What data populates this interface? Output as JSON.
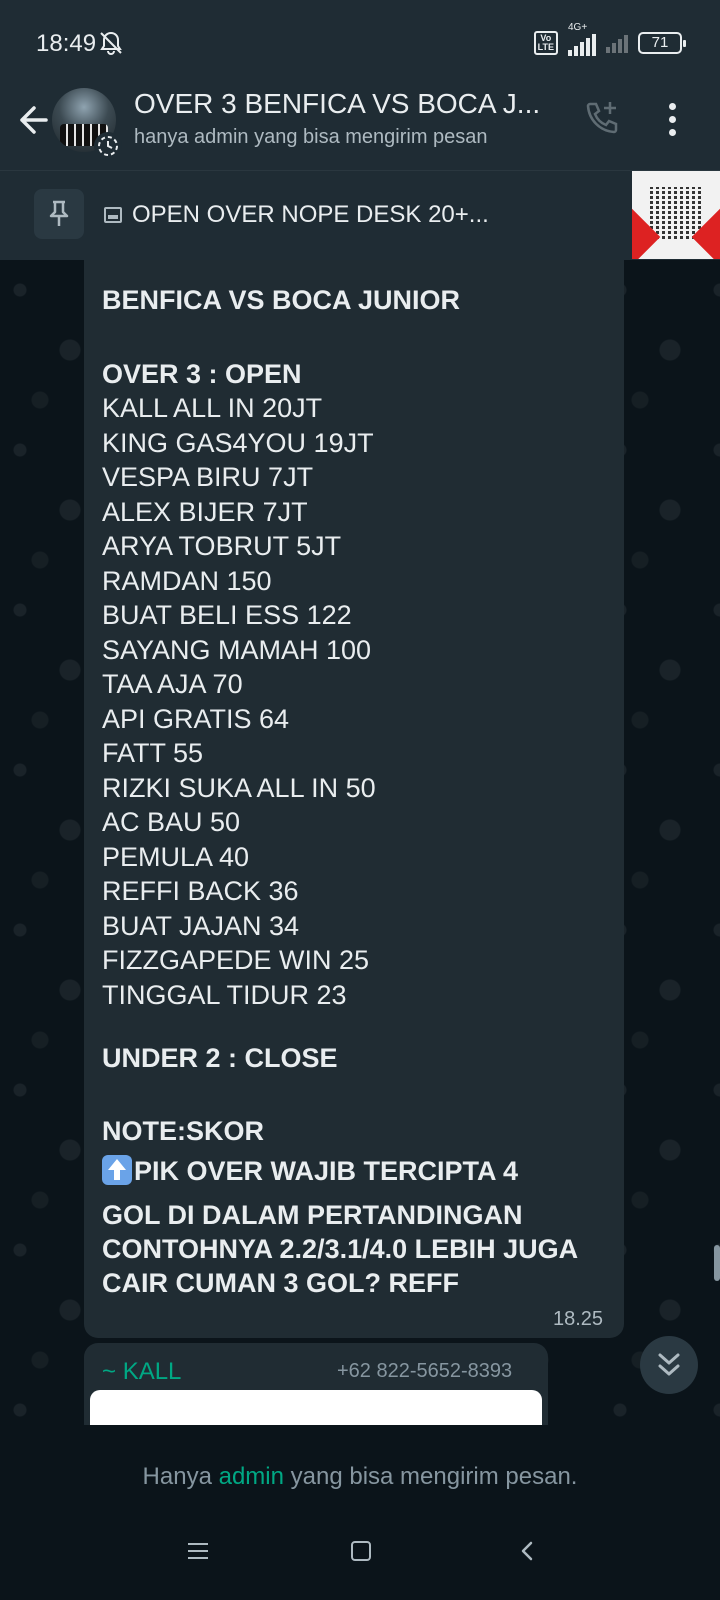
{
  "status_bar": {
    "time": "18:49",
    "network": "4G+",
    "volte": "Vo LTE",
    "battery": "71",
    "icons": [
      "bell-off-icon",
      "volte-icon",
      "signal-icon",
      "signal-no-service-icon",
      "battery-icon"
    ]
  },
  "header": {
    "title": "OVER 3 BENFICA VS BOCA J...",
    "subtitle": "hanya admin yang bisa mengirim pesan",
    "icons": [
      "back-arrow-icon",
      "group-avatar",
      "add-call-icon",
      "more-vert-icon"
    ]
  },
  "pinned": {
    "text": "OPEN OVER NOPE DESK 20+..."
  },
  "message": {
    "heading": "BENFICA VS BOCA JUNIOR",
    "open_label": "OVER 3 : OPEN",
    "entries": [
      "KALL ALL IN 20JT",
      "KING GAS4YOU 19JT",
      "VESPA BIRU 7JT",
      "ALEX BIJER 7JT",
      "ARYA TOBRUT 5JT",
      "RAMDAN 150",
      "BUAT BELI ESS 122",
      "SAYANG MAMAH 100",
      "TAA AJA 70",
      "API GRATIS 64",
      "FATT 55",
      "RIZKI SUKA ALL IN 50",
      "AC BAU 50",
      "PEMULA 40",
      "REFFI BACK 36",
      "BUAT JAJAN 34",
      "FIZZGAPEDE WIN 25",
      "TINGGAL TIDUR 23"
    ],
    "close_label": "UNDER 2 : CLOSE",
    "note_label": "NOTE:SKOR",
    "note_lines": [
      "PIK OVER WAJIB TERCIPTA 4",
      "GOL DI DALAM PERTANDINGAN",
      "CONTOHNYA 2.2/3.1/4.0 LEBIH JUGA",
      "CAIR CUMAN 3 GOL? REFF"
    ],
    "time": "18.25"
  },
  "next_message": {
    "sender_prefix": "~ ",
    "sender": "KALL",
    "phone": "+62 822-5652-8393"
  },
  "footer": {
    "text_before": "Hanya ",
    "text_admin": "admin",
    "text_after": " yang bisa mengirim pesan."
  }
}
